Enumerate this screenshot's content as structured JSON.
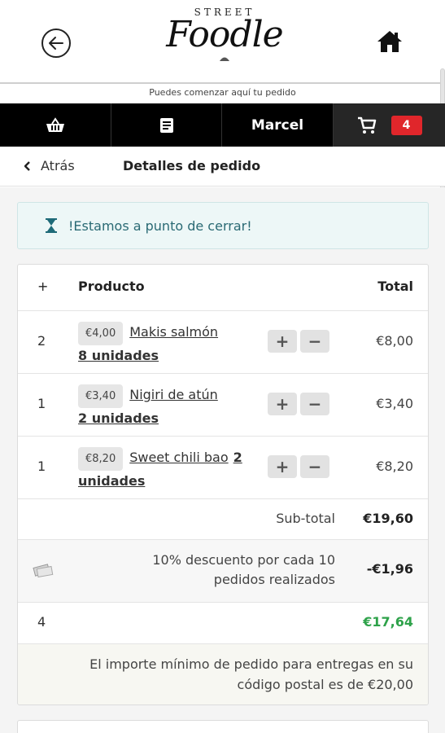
{
  "header": {
    "logo_street": "STREET",
    "logo_foodle": "Foodle",
    "back_icon": "back-arrow-circle-icon",
    "home_icon": "home-icon"
  },
  "tagline": "Puedes comenzar aquí tu pedido",
  "nav": {
    "basket_icon": "basket-icon",
    "menu_icon": "menu-book-icon",
    "user_name": "Marcel",
    "cart_icon": "cart-icon",
    "cart_count": "4",
    "badge_color": "#e0262b"
  },
  "subheader": {
    "back_label": "Atrás",
    "title": "Detalles de pedido"
  },
  "alert": {
    "icon": "hourglass-icon",
    "text": "!Estamos a punto de cerrar!"
  },
  "table": {
    "col_qty": "+",
    "col_product": "Producto",
    "col_total": "Total",
    "items": [
      {
        "qty": "2",
        "unit_price": "€4,00",
        "name": "Makis salmón",
        "units": "8 unidades",
        "total": "€8,00"
      },
      {
        "qty": "1",
        "unit_price": "€3,40",
        "name": "Nigiri de atún",
        "units": "2 unidades",
        "total": "€3,40"
      },
      {
        "qty": "1",
        "unit_price": "€8,20",
        "name": "Sweet chili bao",
        "units": "2 unidades",
        "total": "€8,20"
      }
    ],
    "subtotal_label": "Sub-total",
    "subtotal_value": "€19,60",
    "discount_icon": "money-icon",
    "discount_label": "10% descuento por cada 10 pedidos realizados",
    "discount_value": "-€1,96",
    "total_qty": "4",
    "total_value": "€17,64",
    "total_color": "#2ea24a",
    "minimum_note": "El importe mínimo de pedido para entregas en su código postal es de €20,00"
  }
}
